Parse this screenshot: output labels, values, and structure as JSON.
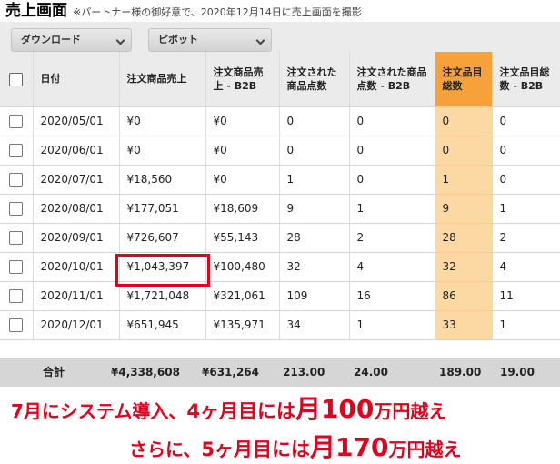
{
  "header": {
    "title": "売上画面",
    "note": "※パートナー様の御好意で、2020年12月14日に売上画面を撮影"
  },
  "toolbar": {
    "download_label": "ダウンロード",
    "pivot_label": "ピボット"
  },
  "table": {
    "columns": [
      "日付",
      "注文商品売上",
      "注文商品売上 - B2B",
      "注文された商品点数",
      "注文された商品点数 - B2B",
      "注文品目総数",
      "注文品目総数 - B2B"
    ],
    "rows": [
      {
        "date": "2020/05/01",
        "sales": "¥0",
        "sales_b2b": "¥0",
        "units": "0",
        "units_b2b": "0",
        "items": "0",
        "items_b2b": "0"
      },
      {
        "date": "2020/06/01",
        "sales": "¥0",
        "sales_b2b": "¥0",
        "units": "0",
        "units_b2b": "0",
        "items": "0",
        "items_b2b": "0"
      },
      {
        "date": "2020/07/01",
        "sales": "¥18,560",
        "sales_b2b": "¥0",
        "units": "1",
        "units_b2b": "0",
        "items": "1",
        "items_b2b": "0"
      },
      {
        "date": "2020/08/01",
        "sales": "¥177,051",
        "sales_b2b": "¥18,609",
        "units": "9",
        "units_b2b": "1",
        "items": "9",
        "items_b2b": "1"
      },
      {
        "date": "2020/09/01",
        "sales": "¥726,607",
        "sales_b2b": "¥55,143",
        "units": "28",
        "units_b2b": "2",
        "items": "28",
        "items_b2b": "2"
      },
      {
        "date": "2020/10/01",
        "sales": "¥1,043,397",
        "sales_b2b": "¥100,480",
        "units": "32",
        "units_b2b": "4",
        "items": "32",
        "items_b2b": "4"
      },
      {
        "date": "2020/11/01",
        "sales": "¥1,721,048",
        "sales_b2b": "¥321,061",
        "units": "109",
        "units_b2b": "16",
        "items": "86",
        "items_b2b": "11"
      },
      {
        "date": "2020/12/01",
        "sales": "¥651,945",
        "sales_b2b": "¥135,971",
        "units": "34",
        "units_b2b": "1",
        "items": "33",
        "items_b2b": "1"
      }
    ],
    "totals": {
      "label": "合計",
      "sales": "¥4,338,608",
      "sales_b2b": "¥631,264",
      "units": "213.00",
      "units_b2b": "24.00",
      "items": "189.00",
      "items_b2b": "19.00"
    }
  },
  "callouts": {
    "line1": {
      "part1": "7月にシステム導入、",
      "part2": "4ヶ月目には",
      "part3": "月100",
      "part4": "万円越え"
    },
    "line2": {
      "part1": "さらに、",
      "part2": "5ヶ月目には",
      "part3": "月170",
      "part4": "万円越え"
    }
  },
  "colors": {
    "highlight_header": "#f6a13a",
    "highlight_cell": "#fcd8a3",
    "callout_red": "#e4001c"
  }
}
